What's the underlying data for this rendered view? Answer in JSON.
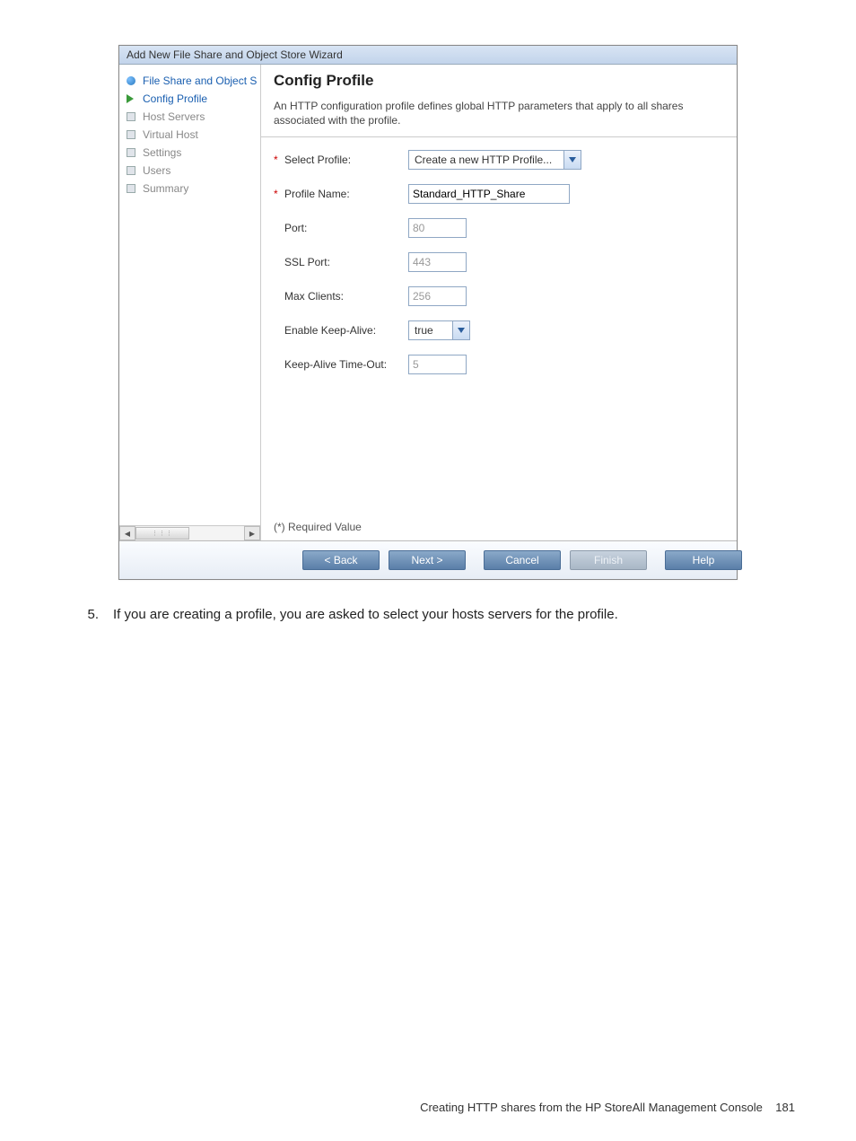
{
  "dialog": {
    "title": "Add New File Share and Object Store Wizard",
    "nav": [
      {
        "label": "File Share and Object S",
        "state": "done"
      },
      {
        "label": "Config Profile",
        "state": "current"
      },
      {
        "label": "Host Servers",
        "state": "pending"
      },
      {
        "label": "Virtual Host",
        "state": "pending"
      },
      {
        "label": "Settings",
        "state": "pending"
      },
      {
        "label": "Users",
        "state": "pending"
      },
      {
        "label": "Summary",
        "state": "pending"
      }
    ],
    "heading": "Config Profile",
    "description": "An HTTP configuration profile defines global HTTP parameters that apply to all shares associated with the profile.",
    "fields": {
      "selectProfile": {
        "label": "Select Profile:",
        "value": "Create a new HTTP Profile...",
        "required": true
      },
      "profileName": {
        "label": "Profile Name:",
        "value": "Standard_HTTP_Share",
        "required": true
      },
      "port": {
        "label": "Port:",
        "value": "80"
      },
      "sslPort": {
        "label": "SSL Port:",
        "value": "443"
      },
      "maxClients": {
        "label": "Max Clients:",
        "value": "256"
      },
      "keepAlive": {
        "label": "Enable Keep-Alive:",
        "value": "true"
      },
      "keepAliveTimeout": {
        "label": "Keep-Alive Time-Out:",
        "value": "5"
      }
    },
    "requiredNote": "(*) Required Value",
    "buttons": {
      "back": "< Back",
      "next": "Next >",
      "cancel": "Cancel",
      "finish": "Finish",
      "help": "Help"
    }
  },
  "step": {
    "number": "5.",
    "text": "If you are creating a profile, you are asked to select your hosts servers for the profile."
  },
  "footer": {
    "text": "Creating HTTP shares from the HP StoreAll Management Console",
    "page": "181"
  }
}
